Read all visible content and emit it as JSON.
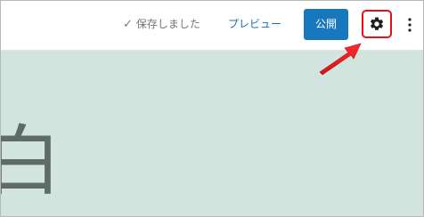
{
  "toolbar": {
    "saved_status": "保存しました",
    "preview_label": "プレビュー",
    "publish_label": "公開"
  },
  "editor": {
    "heading_text": "白"
  },
  "colors": {
    "publish_bg": "#1778bd",
    "link": "#1a6fb3",
    "highlight_box": "#e1111c",
    "arrow": "#ee1c24",
    "editor_bg": "#d1e4dd",
    "heading_text": "#5f6b68"
  },
  "icons": {
    "check": "check-icon",
    "settings": "gear-icon",
    "more": "vertical-ellipsis-icon",
    "annotation": "red-arrow-icon"
  }
}
